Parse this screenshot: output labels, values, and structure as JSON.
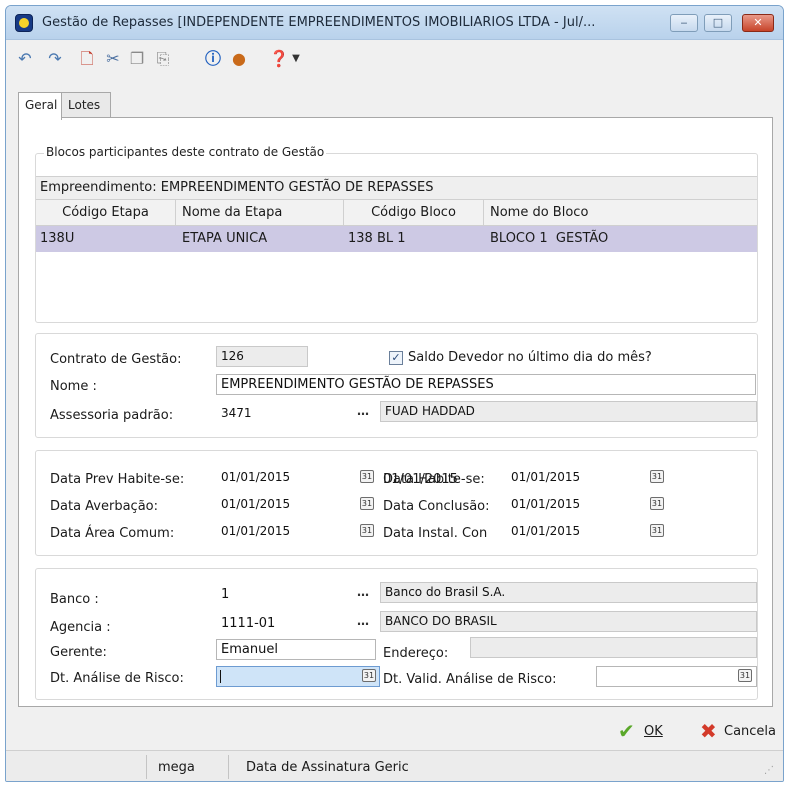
{
  "window": {
    "title": "Gestão de Repasses [INDEPENDENTE EMPREENDIMENTOS IMOBILIARIOS LTDA - Jul/...",
    "minimize_glyph": "‒",
    "maximize_glyph": "□",
    "close_glyph": "✕"
  },
  "toolbar": {
    "icons": [
      "undo-icon",
      "redo-icon",
      "new-document-icon",
      "cut-icon",
      "copy-icon",
      "paste-icon",
      "info-icon",
      "user-icon",
      "help-icon",
      "chevron-down-icon"
    ]
  },
  "tabs": [
    {
      "label": "Geral",
      "active": true
    },
    {
      "label": "Lotes",
      "active": false
    }
  ],
  "blocos": {
    "group_title": "Blocos participantes deste contrato de Gestão",
    "empreendimento_label": "Empreendimento: EMPREENDIMENTO GESTÃO DE REPASSES",
    "columns": [
      "Código Etapa",
      "Nome da Etapa",
      "Código Bloco",
      "Nome do Bloco"
    ],
    "rows": [
      [
        "138U",
        "ETAPA UNICA",
        "138 BL 1",
        "BLOCO 1  GESTÃO"
      ]
    ]
  },
  "contrato": {
    "contrato_label": "Contrato de Gestão:",
    "contrato_value": "126",
    "saldo_checkbox_label": "Saldo Devedor no último dia do mês?",
    "saldo_checked": true,
    "nome_label": "Nome :",
    "nome_value": "EMPREENDIMENTO GESTÃO DE REPASSES",
    "assessoria_label": "Assessoria padrão:",
    "assessoria_code": "3471",
    "assessoria_name": "FUAD HADDAD"
  },
  "datas": {
    "prev_habite_label": "Data Prev Habite-se:",
    "prev_habite_value": "01/01/2015",
    "habite_label": "Data Habite-se:",
    "habite_value": "01/01/2015",
    "averbacao_label": "Data Averbação:",
    "averbacao_value": "01/01/2015",
    "conclusao_label": "Data Conclusão:",
    "conclusao_value": "01/01/2015",
    "area_comum_label": "Data Área Comum:",
    "area_comum_value": "01/01/2015",
    "instal_label": "Data Instal. Con",
    "instal_value": "01/01/2015"
  },
  "banco": {
    "banco_label": "Banco :",
    "banco_code": "1",
    "banco_name": "Banco do Brasil S.A.",
    "agencia_label": "Agencia :",
    "agencia_code": "1111-01",
    "agencia_name": "BANCO DO BRASIL",
    "gerente_label": "Gerente:",
    "gerente_value": "Emanuel",
    "endereco_label": "Endereço:",
    "endereco_value": "",
    "dt_analise_label": "Dt. Análise de Risco:",
    "dt_analise_value": "",
    "dt_valid_label": "Dt. Valid. Análise de Risco:",
    "dt_valid_value": ""
  },
  "actions": {
    "ok_label": "OK",
    "cancel_label": "Cancela"
  },
  "status": {
    "user": "mega",
    "message": "Data de Assinatura Geric"
  },
  "colors": {
    "selected_row": "#cdc9e4",
    "ok_green": "#5aa82a",
    "cancel_red": "#d33a2a"
  }
}
